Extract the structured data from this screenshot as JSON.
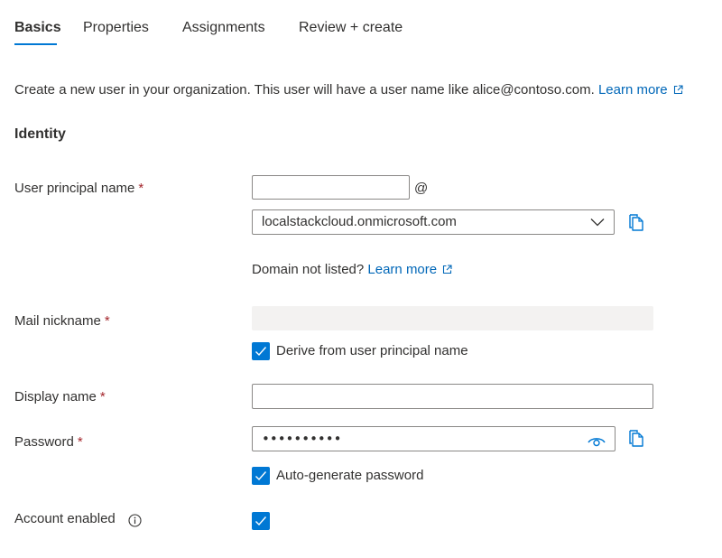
{
  "tabs": [
    {
      "label": "Basics",
      "active": true
    },
    {
      "label": "Properties",
      "active": false
    },
    {
      "label": "Assignments",
      "active": false
    },
    {
      "label": "Review + create",
      "active": false
    }
  ],
  "intro": {
    "text": "Create a new user in your organization. This user will have a user name like alice@contoso.com.",
    "link_label": "Learn more"
  },
  "identity": {
    "title": "Identity",
    "upn": {
      "label": "User principal name",
      "required_mark": "*",
      "value": "",
      "at_symbol": "@",
      "domain_selected": "localstackcloud.onmicrosoft.com",
      "domain_hint": "Domain not listed?",
      "domain_hint_link": "Learn more"
    },
    "mail_nickname": {
      "label": "Mail nickname",
      "required_mark": "*",
      "value": "",
      "derive_checked": true,
      "derive_label": "Derive from user principal name"
    },
    "display_name": {
      "label": "Display name",
      "required_mark": "*",
      "value": ""
    },
    "password": {
      "label": "Password",
      "required_mark": "*",
      "masked_value": "••••••••••",
      "autogen_checked": true,
      "autogen_label": "Auto-generate password"
    },
    "account_enabled": {
      "label": "Account enabled",
      "checked": true
    }
  },
  "colors": {
    "accent": "#0078d4",
    "link": "#0067b8",
    "required": "#a4262c",
    "border": "#8a8886",
    "disabled_bg": "#f3f2f1"
  },
  "icons": {
    "external_link": "external-link-icon",
    "copy": "copy-icon",
    "chevron": "chevron-down-icon",
    "eye": "eye-icon",
    "info": "info-icon",
    "check": "checkmark-icon"
  }
}
